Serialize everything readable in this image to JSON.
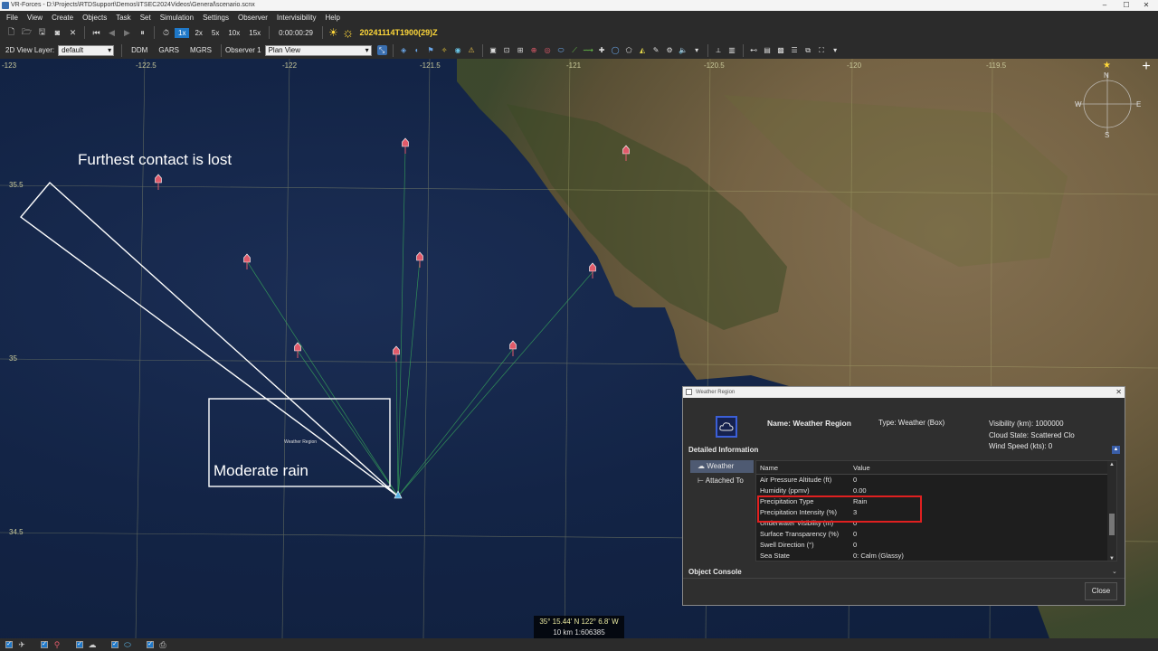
{
  "window": {
    "title": "VR-Forces - D:\\Projects\\RTDSupport\\Demos\\ITSEC2024Videos\\General\\scenario.scnx",
    "minimize": "–",
    "maximize": "☐",
    "close": "✕"
  },
  "menu": [
    "File",
    "View",
    "Create",
    "Objects",
    "Task",
    "Set",
    "Simulation",
    "Settings",
    "Observer",
    "Intervisibility",
    "Help"
  ],
  "toolbar": {
    "speeds": [
      "1x",
      "2x",
      "5x",
      "10x",
      "15x"
    ],
    "active_speed": "1x",
    "elapsed": "0:00:00:29",
    "datetime": "20241114T1900(29)Z"
  },
  "toolbar2": {
    "layer_label": "2D View Layer:",
    "layer_value": "default",
    "coord_buttons": [
      "DDM",
      "GARS",
      "MGRS"
    ],
    "observer_label": "Observer 1",
    "view_value": "Plan View"
  },
  "map": {
    "longitudes": [
      "-123",
      "-122.5",
      "-122",
      "-121.5",
      "-121",
      "-120.5",
      "-120",
      "-119.5"
    ],
    "latitudes": [
      "35.5",
      "35",
      "34.5"
    ],
    "annotations": {
      "contact_lost": "Furthest contact is lost",
      "moderate_rain": "Moderate rain"
    },
    "region_label": "Weather Region",
    "compass": {
      "north": "N",
      "west": "W",
      "east": "E",
      "south": "S"
    },
    "add_button": "+"
  },
  "coordinates": {
    "position": "35° 15.44' N  122° 6.8' W",
    "scale": "10 km    1:606385"
  },
  "dialog": {
    "title": "Weather Region",
    "name": "Name: Weather Region",
    "type": "Type: Weather (Box)",
    "visibility": "Visibility (km): 1000000",
    "cloud_state": "Cloud State: Scattered Clo",
    "wind_speed": "Wind Speed (kts): 0",
    "section": "Detailed Information",
    "tabs": [
      "Weather",
      "Attached To"
    ],
    "columns": [
      "Name",
      "Value"
    ],
    "rows": [
      {
        "name": "Air Pressure Altitude (ft)",
        "value": "0"
      },
      {
        "name": "Humidity (ppmv)",
        "value": "0.00"
      },
      {
        "name": "Precipitation Type",
        "value": "Rain"
      },
      {
        "name": "Precipitation Intensity (%)",
        "value": "3"
      },
      {
        "name": "Underwater Visibility (m)",
        "value": "0"
      },
      {
        "name": "Surface Transparency (%)",
        "value": "0"
      },
      {
        "name": "Swell Direction (°)",
        "value": "0"
      },
      {
        "name": "Sea State",
        "value": "0: Calm (Glassy)"
      }
    ],
    "console": "Object Console",
    "close": "Close"
  },
  "colors": {
    "accent": "#1f78c8",
    "highlight": "#e02020",
    "date": "#ffd83a",
    "unit": "#e05a6a",
    "own": "#59b4e6"
  }
}
